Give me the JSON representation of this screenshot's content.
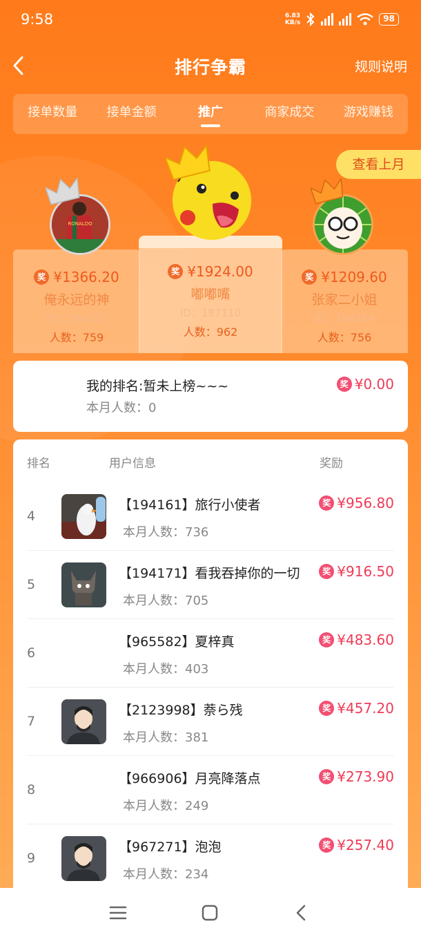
{
  "status": {
    "time": "9:58",
    "net_speed_value": "6.83",
    "net_speed_unit": "KB/s",
    "battery": "98"
  },
  "header": {
    "title": "排行争霸",
    "rules": "规则说明"
  },
  "tabs": [
    {
      "label": "接单数量"
    },
    {
      "label": "接单金额"
    },
    {
      "label": "推广"
    },
    {
      "label": "商家成交"
    },
    {
      "label": "游戏赚钱"
    }
  ],
  "active_tab": "推广",
  "last_month_button": "查看上月",
  "reward_badge": "奖",
  "podium": [
    {
      "rank": 2,
      "reward": "¥1366.20",
      "name": "俺永远的神",
      "id": "ID：194157",
      "count": "人数：759",
      "avatar_text": "RONALDO"
    },
    {
      "rank": 1,
      "reward": "¥1924.00",
      "name": "嘟嘟嘴",
      "id": "ID：187110",
      "count": "人数：962"
    },
    {
      "rank": 3,
      "reward": "¥1209.60",
      "name": "张家二小姐",
      "id": "ID：194169",
      "count": "人数：756"
    }
  ],
  "my_rank": {
    "label": "我的排名:暂未上榜~~~",
    "count": "本月人数：0",
    "reward": "¥0.00"
  },
  "list_headers": {
    "rank": "排名",
    "user": "用户信息",
    "reward": "奖励"
  },
  "rows": [
    {
      "rank": "4",
      "name": "【194161】旅行小使者",
      "count": "本月人数：736",
      "reward": "¥956.80",
      "avatar": "goose"
    },
    {
      "rank": "5",
      "name": "【194171】看我吞掉你的一切",
      "count": "本月人数：705",
      "reward": "¥916.50",
      "avatar": "cat"
    },
    {
      "rank": "6",
      "name": "【965582】夏梓真",
      "count": "本月人数：403",
      "reward": "¥483.60",
      "avatar": "none"
    },
    {
      "rank": "7",
      "name": "【2123998】萘ら残",
      "count": "本月人数：381",
      "reward": "¥457.20",
      "avatar": "man"
    },
    {
      "rank": "8",
      "name": "【966906】月亮降落点",
      "count": "本月人数：249",
      "reward": "¥273.90",
      "avatar": "none"
    },
    {
      "rank": "9",
      "name": "【967271】泡泡",
      "count": "本月人数：234",
      "reward": "¥257.40",
      "avatar": "man"
    }
  ],
  "colors": {
    "accent": "#ff7a1a",
    "reward_pink": "#ee3b57",
    "button_yellow": "#ffe066"
  }
}
